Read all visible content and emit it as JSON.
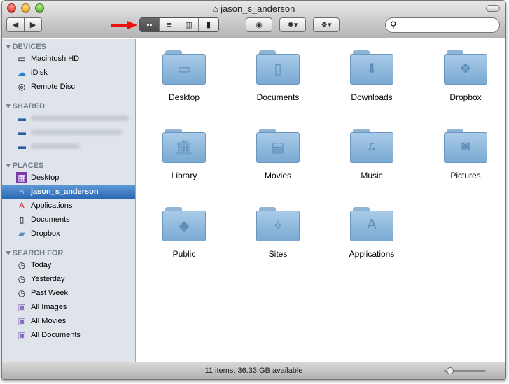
{
  "window": {
    "title": "jason_s_anderson"
  },
  "toolbar": {
    "view_modes": [
      "icon",
      "list",
      "column",
      "cover-flow"
    ],
    "active_view": "icon",
    "search_placeholder": ""
  },
  "sidebar": {
    "devices": {
      "label": "DEVICES",
      "items": [
        "Macintosh HD",
        "iDisk",
        "Remote Disc"
      ]
    },
    "shared": {
      "label": "SHARED"
    },
    "places": {
      "label": "PLACES",
      "items": [
        "Desktop",
        "jason_s_anderson",
        "Applications",
        "Documents",
        "Dropbox"
      ]
    },
    "search_for": {
      "label": "SEARCH FOR",
      "items": [
        "Today",
        "Yesterday",
        "Past Week",
        "All Images",
        "All Movies",
        "All Documents"
      ]
    }
  },
  "content": {
    "items": [
      "Desktop",
      "Documents",
      "Downloads",
      "Dropbox",
      "Library",
      "Movies",
      "Music",
      "Pictures",
      "Public",
      "Sites",
      "Applications"
    ]
  },
  "status": {
    "text": "11 items, 36.33 GB available"
  }
}
